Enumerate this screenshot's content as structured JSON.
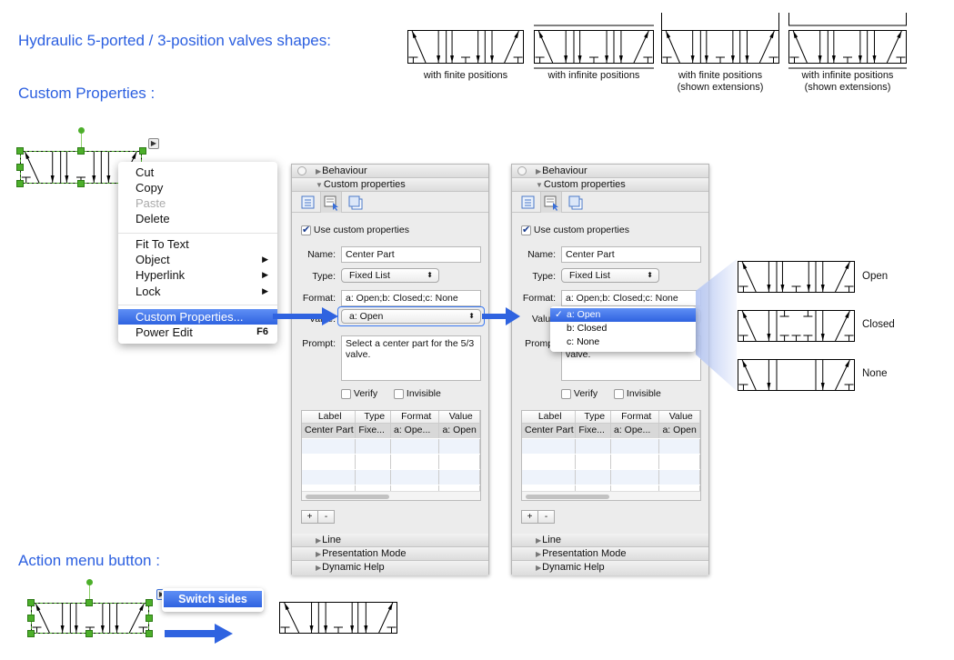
{
  "headings": {
    "valve_shapes": "Hydraulic 5-ported / 3-position valves shapes:",
    "custom_properties": "Custom Properties :",
    "action_menu": "Action menu button :"
  },
  "valve_variants": [
    {
      "caption_1": "with finite positions",
      "caption_2": "",
      "lines": "none"
    },
    {
      "caption_1": "with infinite positions",
      "caption_2": "",
      "lines": "infinite"
    },
    {
      "caption_1": "with finite positions",
      "caption_2": "(shown extensions)",
      "lines": "extensions"
    },
    {
      "caption_1": "with infinite positions",
      "caption_2": "(shown extensions)",
      "lines": "infinite-extensions"
    }
  ],
  "context_menu": {
    "items": [
      {
        "label": "Cut",
        "enabled": true
      },
      {
        "label": "Copy",
        "enabled": true
      },
      {
        "label": "Paste",
        "enabled": false
      },
      {
        "label": "Delete",
        "enabled": true
      },
      {
        "label": "Fit To Text",
        "enabled": true
      },
      {
        "label": "Object",
        "submenu": true
      },
      {
        "label": "Hyperlink",
        "submenu": true
      },
      {
        "label": "Lock",
        "submenu": true
      },
      {
        "label": "Custom Properties...",
        "selected": true
      },
      {
        "label": "Power Edit",
        "shortcut": "F6"
      }
    ],
    "submenu_glyph": "▶"
  },
  "panels": [
    {
      "behaviour": "Behaviour",
      "custom_properties": "Custom properties",
      "use_custom": "Use custom properties",
      "use_custom_checked": true,
      "name_label": "Name:",
      "name_value": "Center Part",
      "type_label": "Type:",
      "type_value": "Fixed List",
      "format_label": "Format:",
      "format_value": "a:  Open;b:  Closed;c:  None",
      "value_label": "Value:",
      "value_value": "a:  Open",
      "prompt_label": "Prompt:",
      "prompt_value": "Select a center part for the 5/3 valve.",
      "verify": "Verify",
      "invisible": "Invisible",
      "columns": [
        "Label",
        "Type",
        "Format",
        "Value"
      ],
      "row": [
        "Center Part",
        "Fixe...",
        "a:  Ope...",
        "a:  Open"
      ],
      "add": "+",
      "remove": "-",
      "line": "Line",
      "presentation": "Presentation Mode",
      "dynamic_help": "Dynamic Help"
    },
    {
      "behaviour": "Behaviour",
      "custom_properties": "Custom properties",
      "use_custom": "Use custom properties",
      "use_custom_checked": true,
      "name_label": "Name:",
      "name_value": "Center Part",
      "type_label": "Type:",
      "type_value": "Fixed List",
      "format_label": "Format:",
      "format_value": "a:  Open;b:  Closed;c:  None",
      "value_label": "Value",
      "value_value": "a:  Open",
      "prompt_label": "Prompt",
      "prompt_value": "Select a center part for the 5/3 valve.",
      "verify": "Verify",
      "invisible": "Invisible",
      "columns": [
        "Label",
        "Type",
        "Format",
        "Value"
      ],
      "row": [
        "Center Part",
        "Fixe...",
        "a:  Ope...",
        "a:  Open"
      ],
      "add": "+",
      "remove": "-",
      "line": "Line",
      "presentation": "Presentation Mode",
      "dynamic_help": "Dynamic Help"
    }
  ],
  "value_dropdown": {
    "options": [
      "a:  Open",
      "b:  Closed",
      "c:  None"
    ],
    "selected_index": 0,
    "check": "✓"
  },
  "center_options": [
    {
      "label": "Open",
      "center": "open"
    },
    {
      "label": "Closed",
      "center": "closed"
    },
    {
      "label": "None",
      "center": "none"
    }
  ],
  "action_menu": {
    "item": "Switch sides",
    "button_glyph": "▶"
  },
  "colors": {
    "heading": "#2b5fe0",
    "selection": "#2f63e0",
    "handle": "#4caf2a",
    "arrow": "#2f63e0"
  }
}
